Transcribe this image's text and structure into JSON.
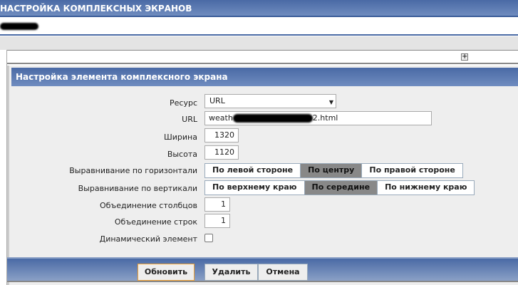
{
  "page": {
    "title": "НАСТРОЙКА КОМПЛЕКСНЫХ ЭКРАНОВ"
  },
  "form": {
    "title": "Настройка элемента комплексного экрана",
    "fields": {
      "resource": {
        "label": "Ресурс",
        "value": "URL"
      },
      "url": {
        "label": "URL",
        "value_start": "weath",
        "value_end": "2.html"
      },
      "width": {
        "label": "Ширина",
        "value": "1320"
      },
      "height": {
        "label": "Высота",
        "value": "1120"
      },
      "halign": {
        "label": "Выравнивание по горизонтали",
        "options": [
          "По левой стороне",
          "По центру",
          "По правой стороне"
        ],
        "selected": "По центру"
      },
      "valign": {
        "label": "Выравнивание по вертикали",
        "options": [
          "По верхнему краю",
          "По середине",
          "По нижнему краю"
        ],
        "selected": "По середине"
      },
      "colspan": {
        "label": "Объединение столбцов",
        "value": "1"
      },
      "rowspan": {
        "label": "Объединение строк",
        "value": "1"
      },
      "dynamic": {
        "label": "Динамический элемент",
        "checked": false
      }
    },
    "buttons": {
      "update": "Обновить",
      "delete": "Удалить",
      "cancel": "Отмена"
    }
  },
  "colors": {
    "header": "#4a6aa5",
    "selected_segment": "#888888",
    "focus_border": "#f0a030"
  }
}
